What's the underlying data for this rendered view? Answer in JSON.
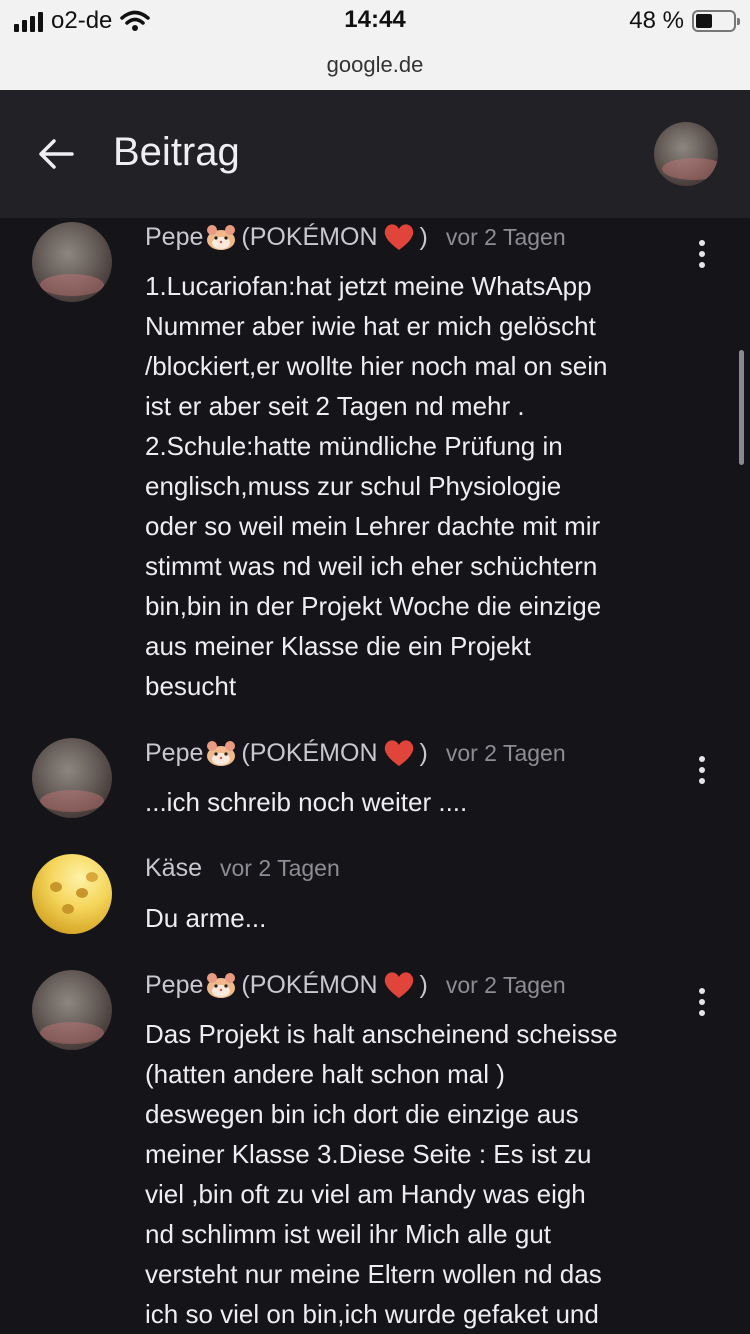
{
  "status_bar": {
    "carrier": "o2-de",
    "time": "14:44",
    "battery": "48 %",
    "battery_level": 0.48
  },
  "url_bar": {
    "host": "google.de"
  },
  "header": {
    "back_icon": "arrow-left-icon",
    "title": "Beitrag"
  },
  "posts": [
    {
      "author": "Pepe",
      "author_suffix_open": "(POKÉMON",
      "author_suffix_close": ")",
      "time": "vor 2 Tagen",
      "text": "1.Lucariofan:hat jetzt meine WhatsApp\nNummer aber iwie hat er mich gelöscht\n/blockiert,er wollte hier noch mal on sein\nist er aber seit 2 Tagen nd mehr .\n2.Schule:hatte mündliche Prüfung in\nenglisch,muss zur schul Physiologie\noder so weil mein Lehrer dachte mit mir\nstimmt was nd weil ich eher schüchtern\nbin,bin in der Projekt Woche die einzige\naus meiner Klasse die ein Projekt\nbesucht"
    },
    {
      "author": "Pepe",
      "author_suffix_open": "(POKÉMON",
      "author_suffix_close": ")",
      "time": "vor 2 Tagen",
      "text": "...ich schreib noch weiter ...."
    },
    {
      "author": "Käse",
      "time": "vor 2 Tagen",
      "text": "Du arme..."
    },
    {
      "author": "Pepe",
      "author_suffix_open": "(POKÉMON",
      "author_suffix_close": ")",
      "time": "vor 2 Tagen",
      "text": "Das Projekt is halt anscheinend scheisse\n(hatten andere halt schon mal )\ndeswegen bin ich dort die einzige aus\nmeiner Klasse 3.Diese Seite : Es ist zu\nviel ,bin oft zu viel am Handy was eigh\nnd schlimm ist weil ihr Mich alle gut\nversteht nur meine Eltern wollen nd das\nich so viel on bin,ich wurde gefaket und"
    }
  ]
}
